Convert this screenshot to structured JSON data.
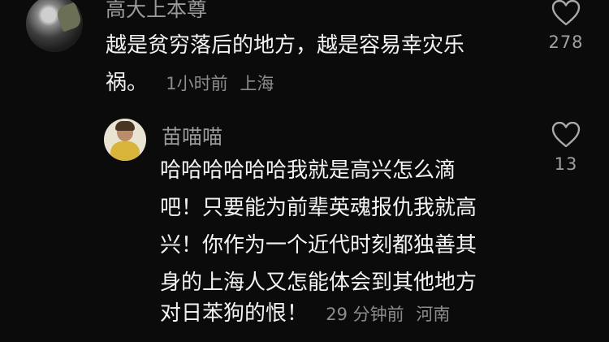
{
  "comments": [
    {
      "username": "高大上本尊",
      "lines": [
        "越是贫穷落后的地方，越是容易幸灾乐",
        "祸。"
      ],
      "time": "1小时前",
      "location": "上海",
      "like_count": "278"
    },
    {
      "username": "苗喵喵",
      "lines": [
        "哈哈哈哈哈哈我就是高兴怎么滴",
        "吧！只要能为前辈英魂报仇我就高",
        "兴！你作为一个近代时刻都独善其",
        "身的上海人又怎能体会到其他地方",
        "对日苯狗的恨！"
      ],
      "time": "29 分钟前",
      "location": "河南",
      "like_count": "13"
    }
  ],
  "icons": {
    "like": "heart-outline-icon"
  },
  "colors": {
    "background": "#0b0b0b",
    "text": "#f3f3f3",
    "muted": "#8d8d8d"
  }
}
